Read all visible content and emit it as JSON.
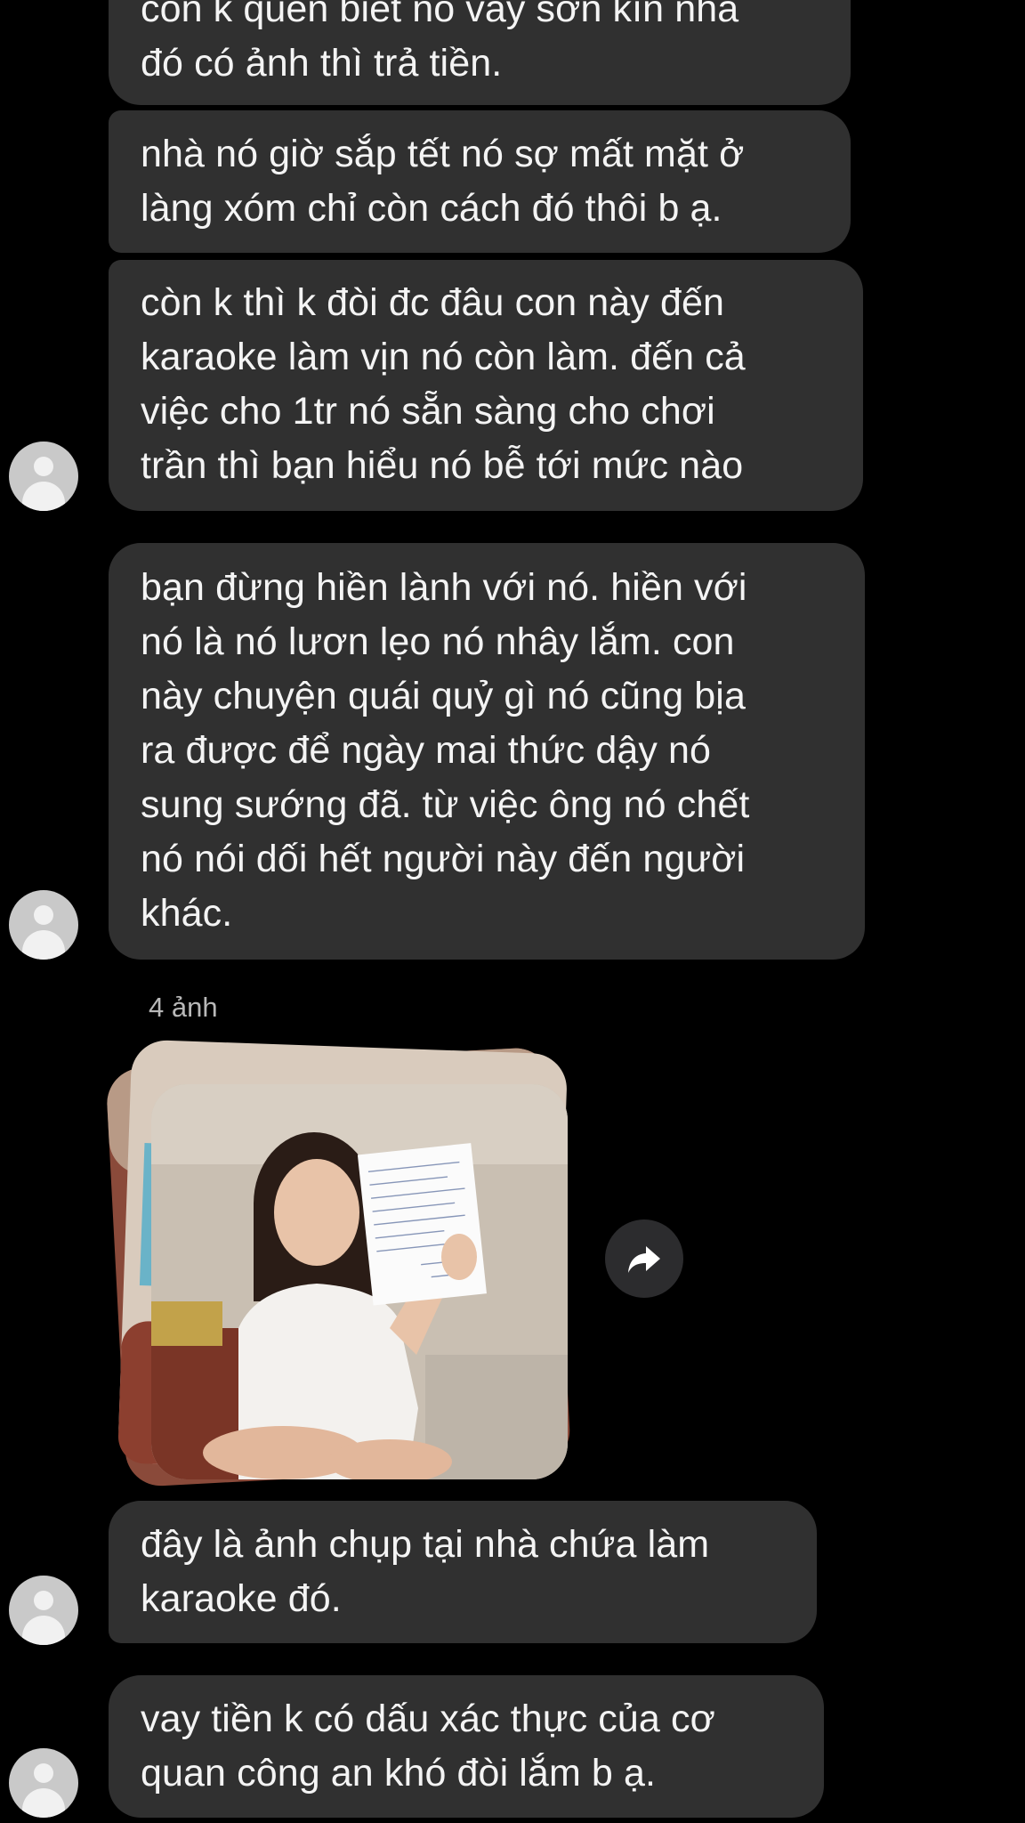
{
  "messages": [
    {
      "text": "còn k quên biết nó vay sơn kìn nha\nđó có ảnh thì trả tiền."
    },
    {
      "text": "nhà nó giờ sắp tết nó sợ mất mặt ở\nlàng xóm chỉ còn cách đó thôi b ạ."
    },
    {
      "text": "còn k thì k đòi đc đâu con này đến\nkaraoke làm vịn nó còn làm. đến cả\nviệc cho 1tr nó sẵn sàng cho chơi\ntrần thì bạn hiểu nó bễ tới mức nào"
    },
    {
      "text": "bạn đừng hiền lành với nó. hiền với\nnó là nó lươn lẹo nó nhây lắm. con\nnày chuyện quái quỷ gì nó cũng bịa\nra được để ngày mai thức dậy nó\nsung sướng đã. từ việc ông nó chết\nnó nói dối hết người này đến người\nkhác."
    },
    {
      "text": "đây là ảnh chụp tại nhà chứa làm\nkaraoke đó."
    },
    {
      "text": "vay tiền k có dấu xác thực của cơ\nquan công an khó đòi lắm b ạ."
    }
  ],
  "photo_group": {
    "caption": "4 ảnh",
    "count": 4
  },
  "share_button": {
    "icon": "share-arrow-icon"
  },
  "avatar": {
    "icon": "default-user-avatar-icon"
  },
  "colors": {
    "background": "#000000",
    "bubble": "#303030",
    "text": "#f4f4f4",
    "caption": "#b8b8b8"
  }
}
